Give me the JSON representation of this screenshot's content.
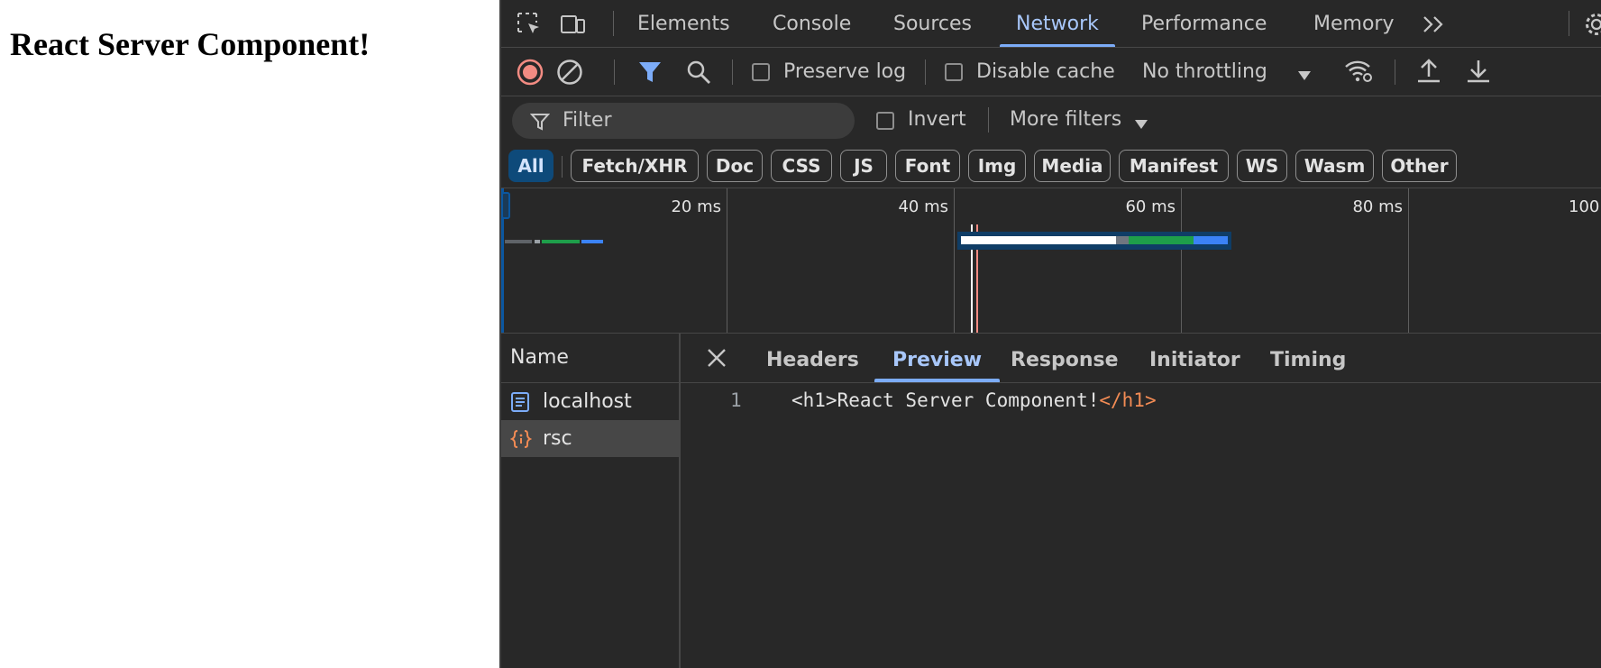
{
  "page": {
    "heading": "React Server Component!"
  },
  "devtools": {
    "tabs": [
      "Elements",
      "Console",
      "Sources",
      "Network",
      "Performance",
      "Memory"
    ],
    "active_tab": "Network",
    "toolbar": {
      "preserve_log": "Preserve log",
      "disable_cache": "Disable cache",
      "throttling": "No throttling"
    },
    "filter": {
      "placeholder": "Filter",
      "invert": "Invert",
      "more_filters": "More filters"
    },
    "type_filters": [
      "All",
      "Fetch/XHR",
      "Doc",
      "CSS",
      "JS",
      "Font",
      "Img",
      "Media",
      "Manifest",
      "WS",
      "Wasm",
      "Other"
    ],
    "active_type_filter": "All",
    "overview": {
      "ticks": [
        "20 ms",
        "40 ms",
        "60 ms",
        "80 ms",
        "100"
      ]
    },
    "requests": {
      "column_header": "Name",
      "items": [
        {
          "name": "localhost",
          "type": "document",
          "selected": false
        },
        {
          "name": "rsc",
          "type": "fetch",
          "selected": true
        }
      ]
    },
    "detail": {
      "tabs": [
        "Headers",
        "Preview",
        "Response",
        "Initiator",
        "Timing"
      ],
      "active_tab": "Preview",
      "line_number": "1",
      "code_open": "<h1>React Server Component!",
      "code_close": "</h1>"
    },
    "colors": {
      "accent": "#a8c7fa",
      "record_red": "#f28b82",
      "filter_blue": "#7cacf8",
      "timing_green": "#1e9e4a",
      "timing_blue": "#3b82f6"
    }
  }
}
